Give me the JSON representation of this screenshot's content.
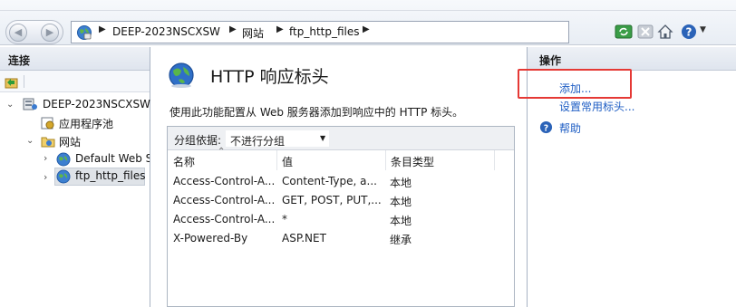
{
  "address_bar": {
    "crumbs": [
      "DEEP-2023NSCXSW",
      "网站",
      "ftp_http_files"
    ]
  },
  "connections": {
    "title": "连接",
    "tree": {
      "server": "DEEP-2023NSCXSW",
      "app_pools": "应用程序池",
      "sites": "网站",
      "site_default": "Default Web S",
      "site_ftp": "ftp_http_files"
    }
  },
  "main": {
    "title": "HTTP 响应标头",
    "description": "使用此功能配置从 Web 服务器添加到响应中的 HTTP 标头。",
    "group_label": "分组依据:",
    "group_value": "不进行分组",
    "columns": [
      "名称",
      "值",
      "条目类型"
    ],
    "rows": [
      {
        "name": "Access-Control-A...",
        "value": "Content-Type, a...",
        "type": "本地"
      },
      {
        "name": "Access-Control-A...",
        "value": "GET, POST, PUT,...",
        "type": "本地"
      },
      {
        "name": "Access-Control-A...",
        "value": "*",
        "type": "本地"
      },
      {
        "name": "X-Powered-By",
        "value": "ASP.NET",
        "type": "继承"
      }
    ]
  },
  "actions": {
    "title": "操作",
    "add": "添加...",
    "common": "设置常用标头...",
    "help": "帮助"
  },
  "colors": {
    "link": "#1f5ec4",
    "highlight": "#e53935",
    "selection": "#dfe3e8"
  }
}
